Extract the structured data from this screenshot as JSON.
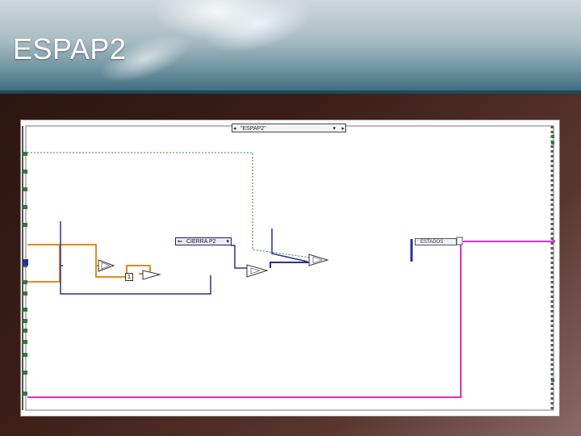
{
  "slide": {
    "title": "ESPAP2"
  },
  "diagram": {
    "case_selector": {
      "value": "\"ESPAP2\""
    },
    "enum_constant": {
      "value": "CIERRA P2"
    },
    "cluster_label": {
      "value": "ESTADOS"
    },
    "numeric_constant": {
      "value": "1"
    }
  },
  "colors": {
    "wire_orange": "#e58a1f",
    "wire_blue": "#2b2f9a",
    "wire_pink": "#e02bd0",
    "wire_green_dotted": "#2c8a3c",
    "terminal_green": "#2e7d32"
  }
}
